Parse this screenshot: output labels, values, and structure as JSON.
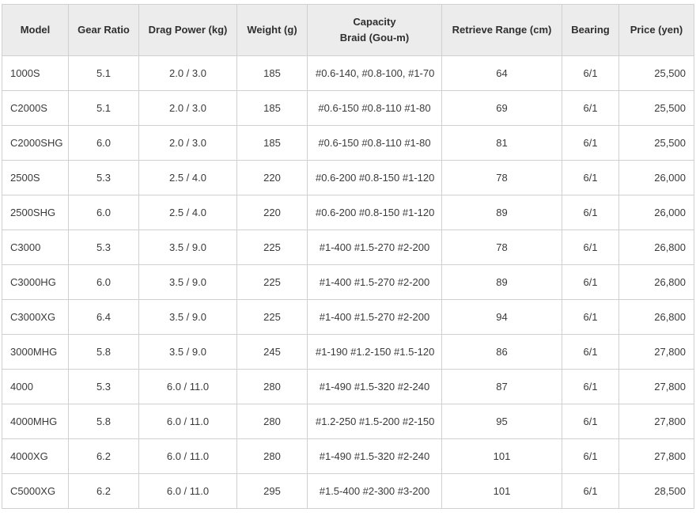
{
  "table": {
    "headers": {
      "model": "Model",
      "gear": "Gear Ratio",
      "drag": "Drag Power (kg)",
      "weight": "Weight (g)",
      "capacity_line1": "Capacity",
      "capacity_line2": "Braid (Gou-m)",
      "retrieve": "Retrieve Range (cm)",
      "bearing": "Bearing",
      "price": "Price (yen)"
    },
    "rows": [
      {
        "model": "1000S",
        "gear": "5.1",
        "drag": "2.0 / 3.0",
        "weight": "185",
        "capacity": "#0.6-140, #0.8-100, #1-70",
        "retrieve": "64",
        "bearing": "6/1",
        "price": "25,500"
      },
      {
        "model": "C2000S",
        "gear": "5.1",
        "drag": "2.0 / 3.0",
        "weight": "185",
        "capacity": "#0.6-150 #0.8-110 #1-80",
        "retrieve": "69",
        "bearing": "6/1",
        "price": "25,500"
      },
      {
        "model": "C2000SHG",
        "gear": "6.0",
        "drag": "2.0 / 3.0",
        "weight": "185",
        "capacity": "#0.6-150 #0.8-110 #1-80",
        "retrieve": "81",
        "bearing": "6/1",
        "price": "25,500"
      },
      {
        "model": "2500S",
        "gear": "5.3",
        "drag": "2.5 / 4.0",
        "weight": "220",
        "capacity": "#0.6-200 #0.8-150 #1-120",
        "retrieve": "78",
        "bearing": "6/1",
        "price": "26,000"
      },
      {
        "model": "2500SHG",
        "gear": "6.0",
        "drag": "2.5 / 4.0",
        "weight": "220",
        "capacity": "#0.6-200 #0.8-150 #1-120",
        "retrieve": "89",
        "bearing": "6/1",
        "price": "26,000"
      },
      {
        "model": "C3000",
        "gear": "5.3",
        "drag": "3.5 / 9.0",
        "weight": "225",
        "capacity": "#1-400 #1.5-270 #2-200",
        "retrieve": "78",
        "bearing": "6/1",
        "price": "26,800"
      },
      {
        "model": "C3000HG",
        "gear": "6.0",
        "drag": "3.5 / 9.0",
        "weight": "225",
        "capacity": "#1-400 #1.5-270 #2-200",
        "retrieve": "89",
        "bearing": "6/1",
        "price": "26,800"
      },
      {
        "model": "C3000XG",
        "gear": "6.4",
        "drag": "3.5 / 9.0",
        "weight": "225",
        "capacity": "#1-400 #1.5-270 #2-200",
        "retrieve": "94",
        "bearing": "6/1",
        "price": "26,800"
      },
      {
        "model": "3000MHG",
        "gear": "5.8",
        "drag": "3.5 / 9.0",
        "weight": "245",
        "capacity": "#1-190 #1.2-150 #1.5-120",
        "retrieve": "86",
        "bearing": "6/1",
        "price": "27,800"
      },
      {
        "model": "4000",
        "gear": "5.3",
        "drag": "6.0 / 11.0",
        "weight": "280",
        "capacity": "#1-490 #1.5-320 #2-240",
        "retrieve": "87",
        "bearing": "6/1",
        "price": "27,800"
      },
      {
        "model": "4000MHG",
        "gear": "5.8",
        "drag": "6.0 / 11.0",
        "weight": "280",
        "capacity": "#1.2-250 #1.5-200 #2-150",
        "retrieve": "95",
        "bearing": "6/1",
        "price": "27,800"
      },
      {
        "model": "4000XG",
        "gear": "6.2",
        "drag": "6.0 / 11.0",
        "weight": "280",
        "capacity": "#1-490 #1.5-320 #2-240",
        "retrieve": "101",
        "bearing": "6/1",
        "price": "27,800"
      },
      {
        "model": "C5000XG",
        "gear": "6.2",
        "drag": "6.0 / 11.0",
        "weight": "295",
        "capacity": "#1.5-400 #2-300 #3-200",
        "retrieve": "101",
        "bearing": "6/1",
        "price": "28,500"
      }
    ]
  }
}
